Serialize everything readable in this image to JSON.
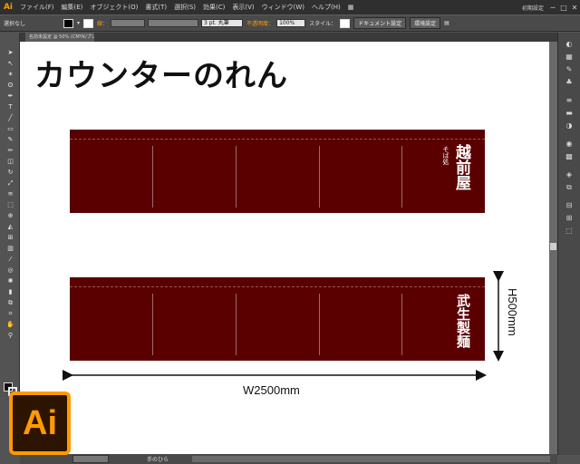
{
  "menu": {
    "logo": "Ai",
    "items": [
      "ファイル(F)",
      "編集(E)",
      "オブジェクト(O)",
      "書式(T)",
      "選択(S)",
      "効果(C)",
      "表示(V)",
      "ウィンドウ(W)",
      "ヘルプ(H)"
    ],
    "workspace": "初期設定",
    "window_controls": [
      "─",
      "□",
      "✕"
    ]
  },
  "control": {
    "selection": "選択なし",
    "stroke_label": "線：",
    "stroke_size": "3 pt. 丸筆",
    "opacity_label": "不透明度：",
    "opacity_value": "100%",
    "style_label": "スタイル：",
    "doc_settings": "ドキュメント設定",
    "prefs": "環境設定"
  },
  "tab": {
    "label": "名前未設定 @ 50% (CMYK/プレビュー)"
  },
  "canvas": {
    "title": "カウンターのれん",
    "noren_top": {
      "shop_name": "越前屋",
      "sub": "そば処"
    },
    "noren_bottom": {
      "shop_name": "武生製麺"
    },
    "width_label": "W2500mm",
    "height_label": "H500mm"
  },
  "status": {
    "tool": "手のひら",
    "zoom": "50%"
  },
  "colors": {
    "noren": "#5a0000",
    "accent": "#ff9a00"
  },
  "icons": [
    "selection-tool-icon",
    "direct-selection-icon",
    "magic-wand-icon",
    "lasso-icon",
    "pen-icon",
    "type-icon",
    "line-icon",
    "rectangle-icon",
    "paintbrush-icon",
    "pencil-icon",
    "eraser-icon",
    "rotate-icon",
    "scale-icon",
    "warp-icon",
    "free-transform-icon",
    "shape-builder-icon",
    "perspective-icon",
    "mesh-icon",
    "gradient-icon",
    "eyedropper-icon",
    "blend-icon",
    "symbol-sprayer-icon",
    "graph-icon",
    "artboard-icon",
    "slice-icon",
    "hand-icon",
    "zoom-icon"
  ]
}
